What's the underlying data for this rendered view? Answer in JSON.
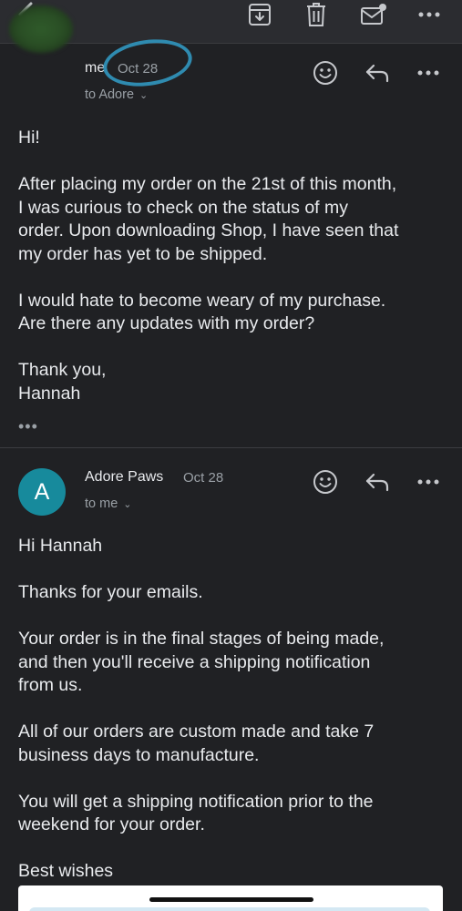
{
  "toolbar": {
    "back_icon": "chevron-left-icon",
    "archive_icon": "archive-icon",
    "trash_icon": "trash-icon",
    "mail_icon": "mark-unread-icon",
    "more_icon": "more-horizontal-icon"
  },
  "messages": [
    {
      "sender": "me",
      "date": "Oct 28",
      "recipient": "to Adore",
      "body": [
        "Hi!",
        "",
        "After placing my order on the 21st of this month,",
        "I was curious to check on the status of my",
        "order.  Upon downloading Shop, I have seen that",
        "my order has yet to be shipped.",
        "",
        "I would hate to become weary of my purchase.",
        "Are there any updates with my order?",
        "",
        "Thank you,",
        "Hannah"
      ],
      "collapsed_quote": "•••"
    },
    {
      "sender": "Adore Paws",
      "avatar_letter": "A",
      "date": "Oct 28",
      "recipient": "to me",
      "body": [
        "Hi Hannah",
        "",
        "Thanks for your emails.",
        "",
        "Your order is in the final stages of being made,",
        "and then you'll receive a shipping notification",
        "from us.",
        "",
        "All of our orders are custom made and take 7",
        "business days to manufacture.",
        "",
        "You will get a shipping notification prior to the",
        "weekend for your order.",
        "",
        "Best wishes"
      ]
    }
  ],
  "colors": {
    "background": "#202124",
    "toolbar": "#2b2c30",
    "avatar": "#178a9c",
    "annotation_ring": "#2f8bb0"
  }
}
